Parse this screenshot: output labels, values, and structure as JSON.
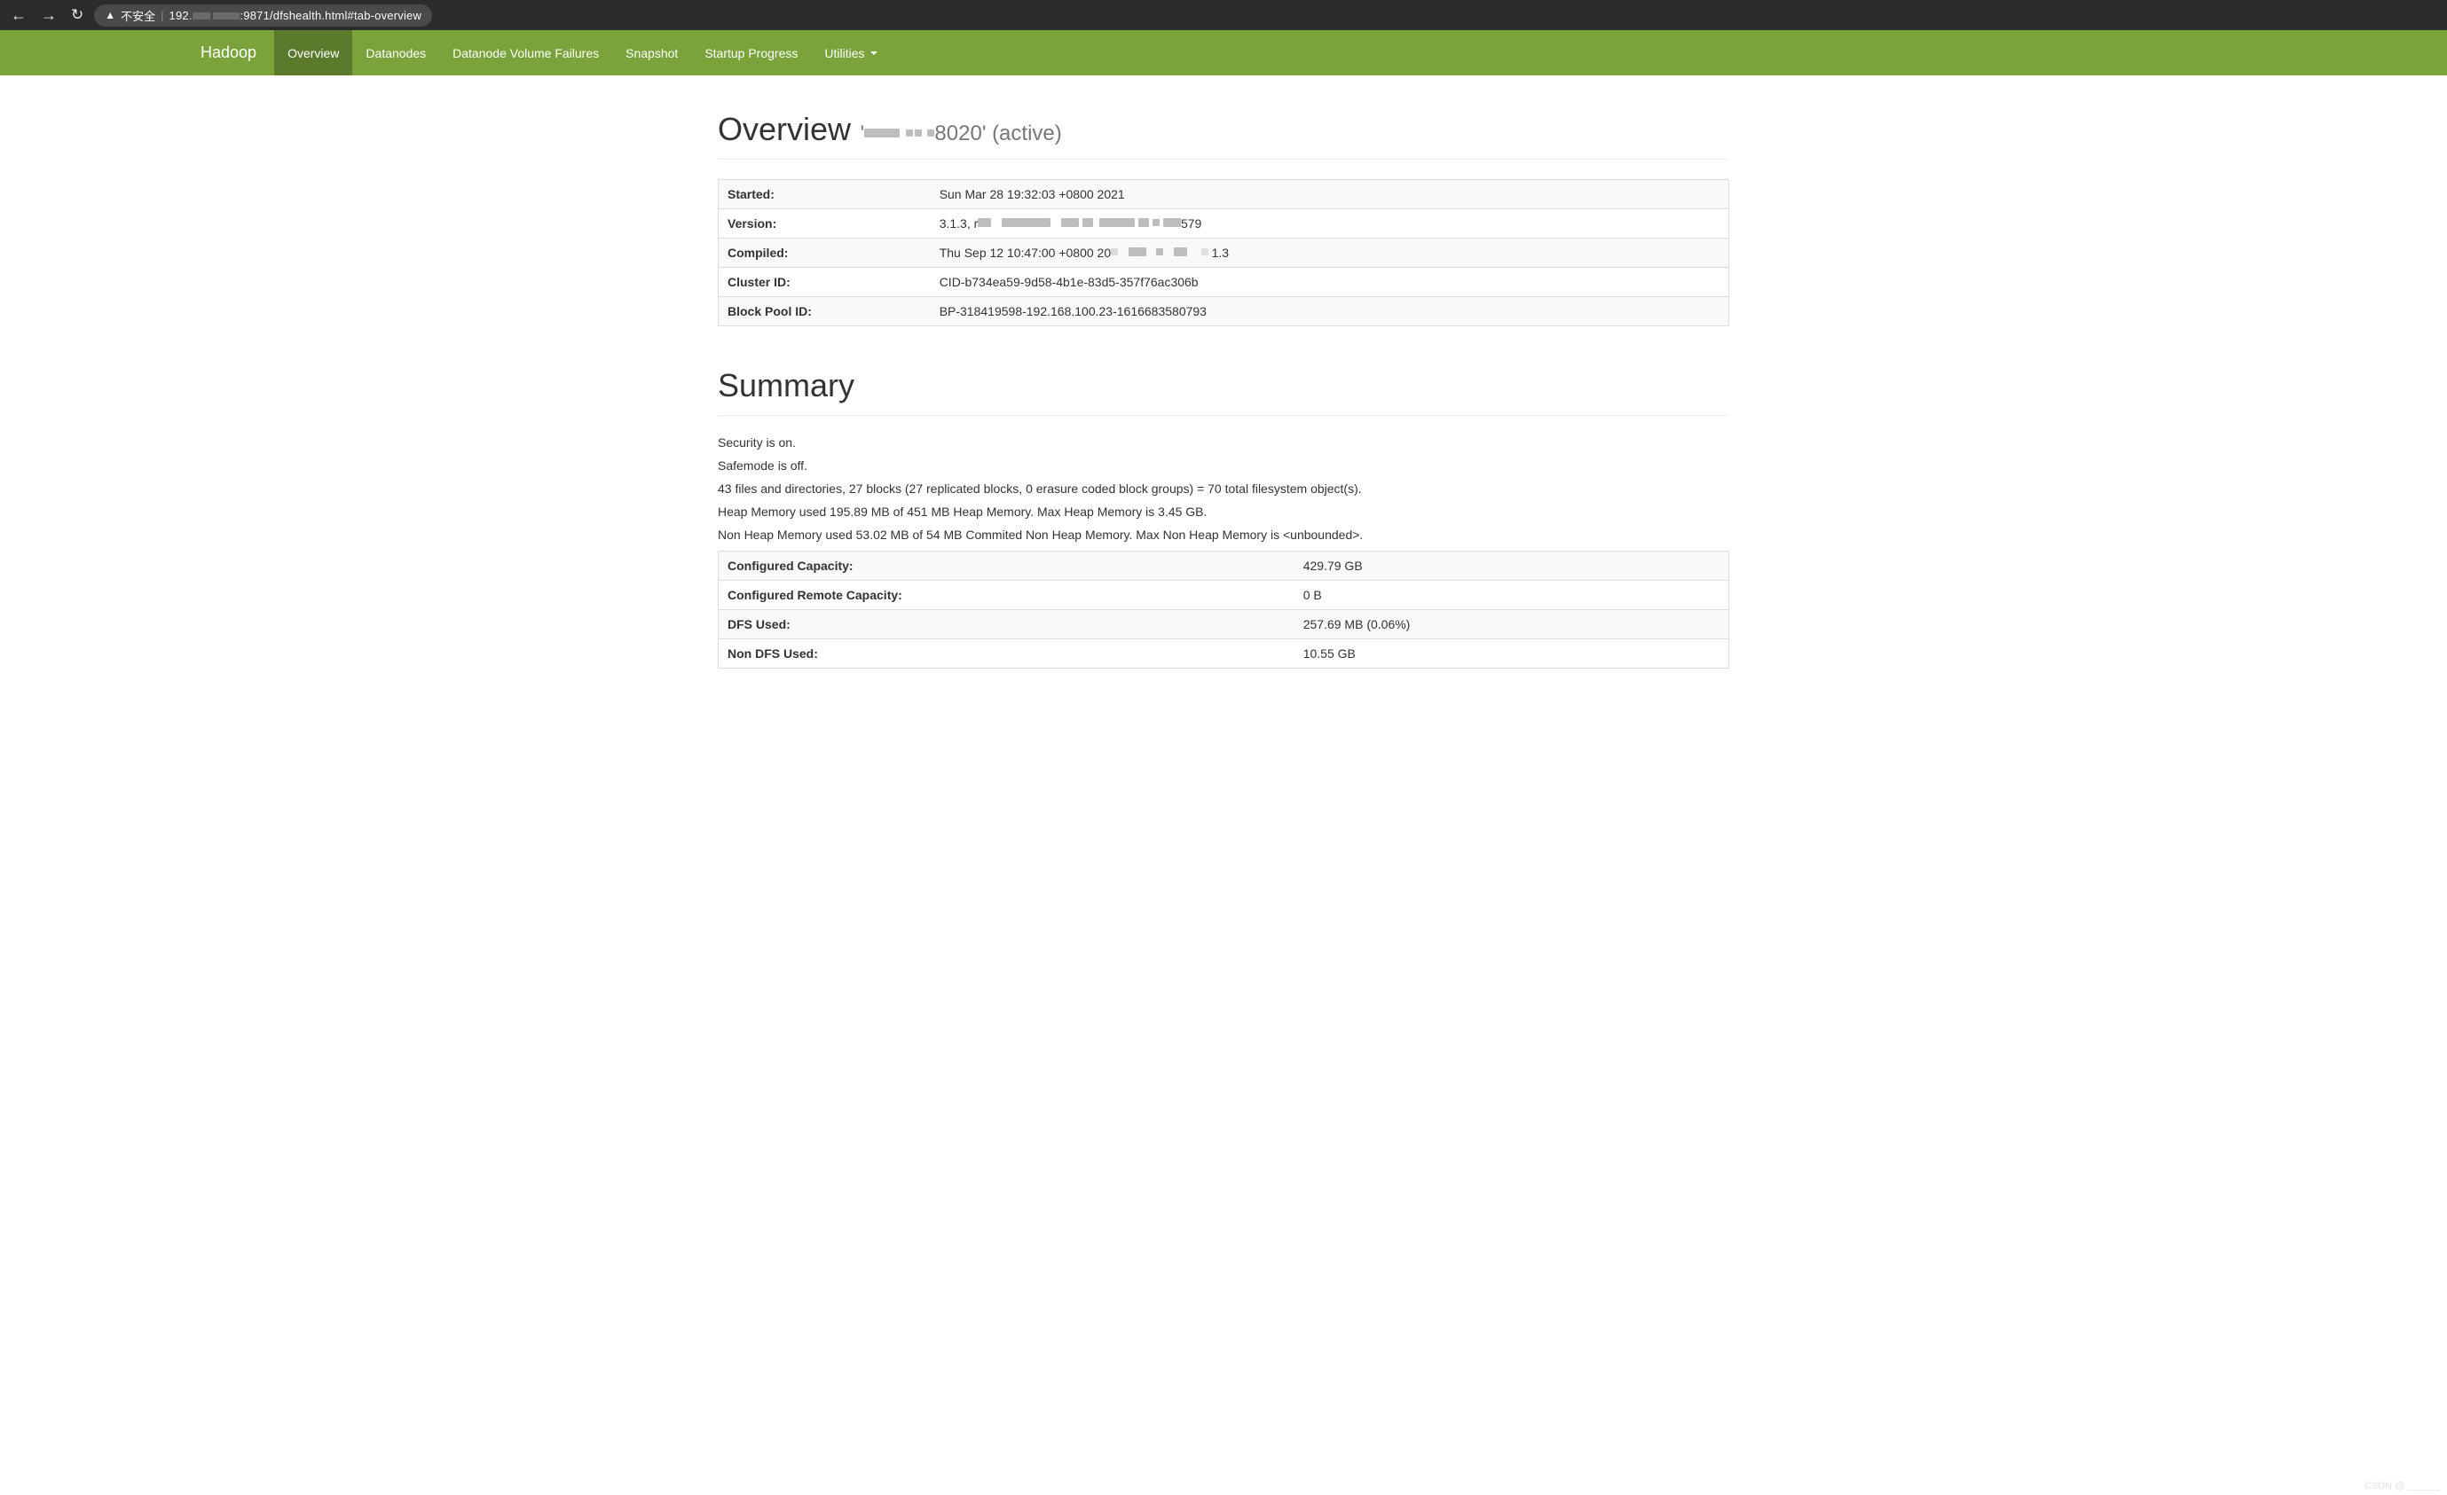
{
  "browser": {
    "insecure_label": "不安全",
    "url_prefix": "192",
    "url_suffix": ":9871/dfshealth.html#tab-overview"
  },
  "nav": {
    "brand": "Hadoop",
    "items": [
      "Overview",
      "Datanodes",
      "Datanode Volume Failures",
      "Snapshot",
      "Startup Progress",
      "Utilities"
    ],
    "active_index": 0
  },
  "header": {
    "title": "Overview",
    "host_prefix": "'",
    "host_suffix": "8020' (active)"
  },
  "info_table": [
    {
      "label": "Started:",
      "value": "Sun Mar 28 19:32:03 +0800 2021"
    },
    {
      "label": "Version:",
      "value_prefix": "3.1.3, r",
      "value_suffix": "579",
      "redacted": true
    },
    {
      "label": "Compiled:",
      "value_prefix": "Thu Sep 12 10:47:00 +0800 20",
      "value_suffix": "  1.3",
      "redacted": true
    },
    {
      "label": "Cluster ID:",
      "value": "CID-b734ea59-9d58-4b1e-83d5-357f76ac306b"
    },
    {
      "label": "Block Pool ID:",
      "value": "BP-318419598-192.168.100.23-1616683580793"
    }
  ],
  "summary": {
    "title": "Summary",
    "lines": [
      "Security is on.",
      "Safemode is off.",
      "43 files and directories, 27 blocks (27 replicated blocks, 0 erasure coded block groups) = 70 total filesystem object(s).",
      "Heap Memory used 195.89 MB of 451 MB Heap Memory. Max Heap Memory is 3.45 GB.",
      "Non Heap Memory used 53.02 MB of 54 MB Commited Non Heap Memory. Max Non Heap Memory is <unbounded>."
    ],
    "table": [
      {
        "label": "Configured Capacity:",
        "value": "429.79 GB"
      },
      {
        "label": "Configured Remote Capacity:",
        "value": "0 B"
      },
      {
        "label": "DFS Used:",
        "value": "257.69 MB (0.06%)"
      },
      {
        "label": "Non DFS Used:",
        "value": "10.55 GB"
      }
    ]
  }
}
